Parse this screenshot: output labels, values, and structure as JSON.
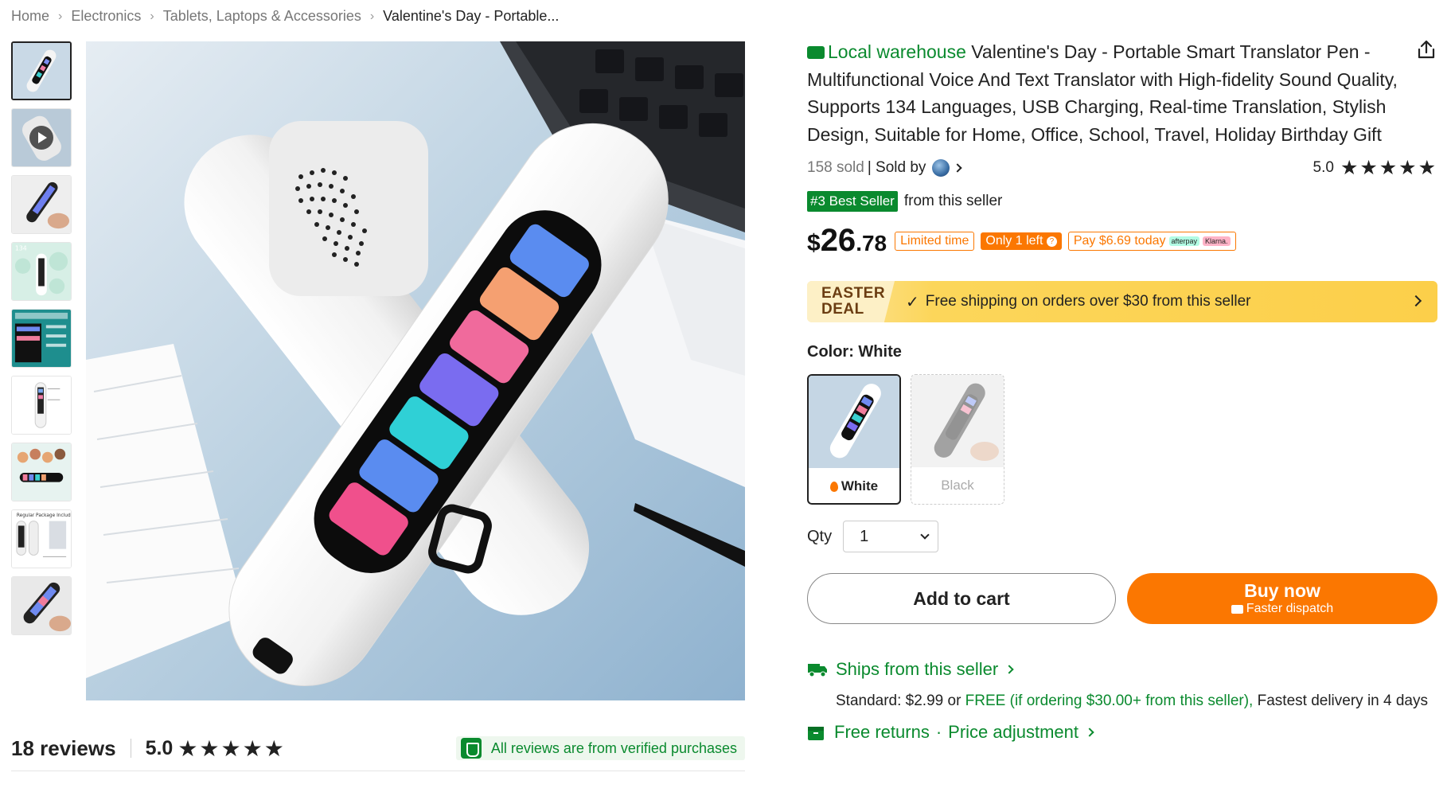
{
  "breadcrumb": [
    "Home",
    "Electronics",
    "Tablets, Laptops & Accessories",
    "Valentine's Day - Portable..."
  ],
  "thumbnails": [
    {
      "name": "thumbnail-1"
    },
    {
      "name": "thumbnail-video"
    },
    {
      "name": "thumbnail-3"
    },
    {
      "name": "thumbnail-4"
    },
    {
      "name": "thumbnail-5"
    },
    {
      "name": "thumbnail-6"
    },
    {
      "name": "thumbnail-7"
    },
    {
      "name": "thumbnail-8"
    },
    {
      "name": "thumbnail-9"
    }
  ],
  "reviews": {
    "count_label": "18 reviews",
    "rating": "5.0",
    "stars": "★★★★★",
    "verified_text": "All reviews are from verified purchases"
  },
  "product": {
    "local_warehouse": "Local warehouse",
    "title": "Valentine's Day - Portable Smart Translator Pen - Multifunctional Voice And Text Translator with High-fidelity Sound Quality, Supports 134 Languages, USB Charging, Real-time Translation, Stylish Design, Suitable for Home, Office, School, Travel, Holiday Birthday Gift",
    "sold": "158 sold",
    "sold_by": "| Sold by",
    "rating": "5.0",
    "stars": "★★★★★",
    "best_seller_badge": "#3 Best Seller",
    "best_seller_suffix": "from this seller"
  },
  "price": {
    "currency": "$",
    "dollars": "26",
    "cents": ".78",
    "limited_time": "Limited time",
    "only_left": "Only 1 left",
    "pay_today": "Pay $6.69 today",
    "afterpay": "afterpay",
    "klarna": "Klarna."
  },
  "deal": {
    "line1": "EASTER",
    "line2": "DEAL",
    "check": "✓",
    "text": "Free shipping on orders over $30 from this seller"
  },
  "color": {
    "label": "Color: White",
    "options": [
      {
        "label": "White",
        "selected": true
      },
      {
        "label": "Black",
        "selected": false
      }
    ]
  },
  "qty": {
    "label": "Qty",
    "value": "1"
  },
  "buttons": {
    "add_to_cart": "Add to cart",
    "buy_now": "Buy now",
    "faster_dispatch": "Faster dispatch"
  },
  "shipping": {
    "ships_from": "Ships from this seller",
    "standard_prefix": "Standard: $2.99 or ",
    "free_text": "FREE (if ordering $30.00+ from this seller),",
    "delivery_suffix": " Fastest delivery in 4 days"
  },
  "returns": {
    "free_returns": "Free returns",
    "dot": "·",
    "price_adjustment": "Price adjustment"
  },
  "colors": {
    "accent_orange": "#fb7701",
    "green": "#0a8a2e"
  }
}
